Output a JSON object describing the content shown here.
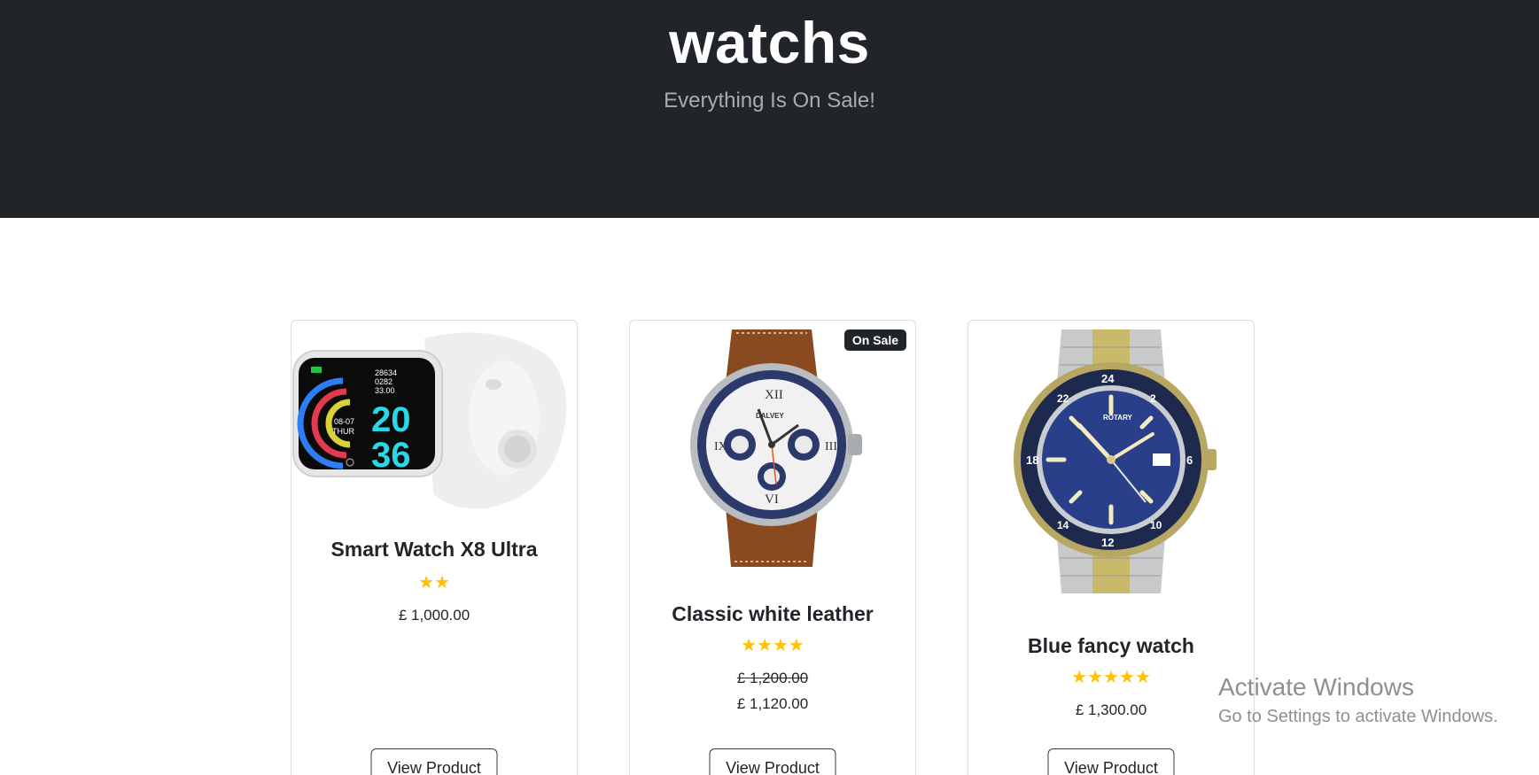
{
  "header": {
    "title": "watchs",
    "subtitle": "Everything Is On Sale!"
  },
  "products": [
    {
      "name": "Smart Watch X8 Ultra",
      "rating": 2,
      "rating_stars": "★★",
      "price": "£ 1,000.00",
      "image": "smart-watch-image",
      "button": "View Product"
    },
    {
      "name": "Classic white leather",
      "rating": 4,
      "rating_stars": "★★★★",
      "badge": "On Sale",
      "old_price": "£ 1,200.00",
      "price": "£ 1,120.00",
      "image": "leather-chronograph-image",
      "button": "View Product"
    },
    {
      "name": "Blue fancy watch",
      "rating": 5,
      "rating_stars": "★★★★★",
      "price": "£ 1,300.00",
      "image": "rotary-gmt-image",
      "button": "View Product"
    }
  ],
  "os_watermark": {
    "line1": "Activate Windows",
    "line2": "Go to Settings to activate Windows."
  },
  "colors": {
    "header_bg": "#212529",
    "star": "#ffc107",
    "badge_bg": "#212529"
  }
}
